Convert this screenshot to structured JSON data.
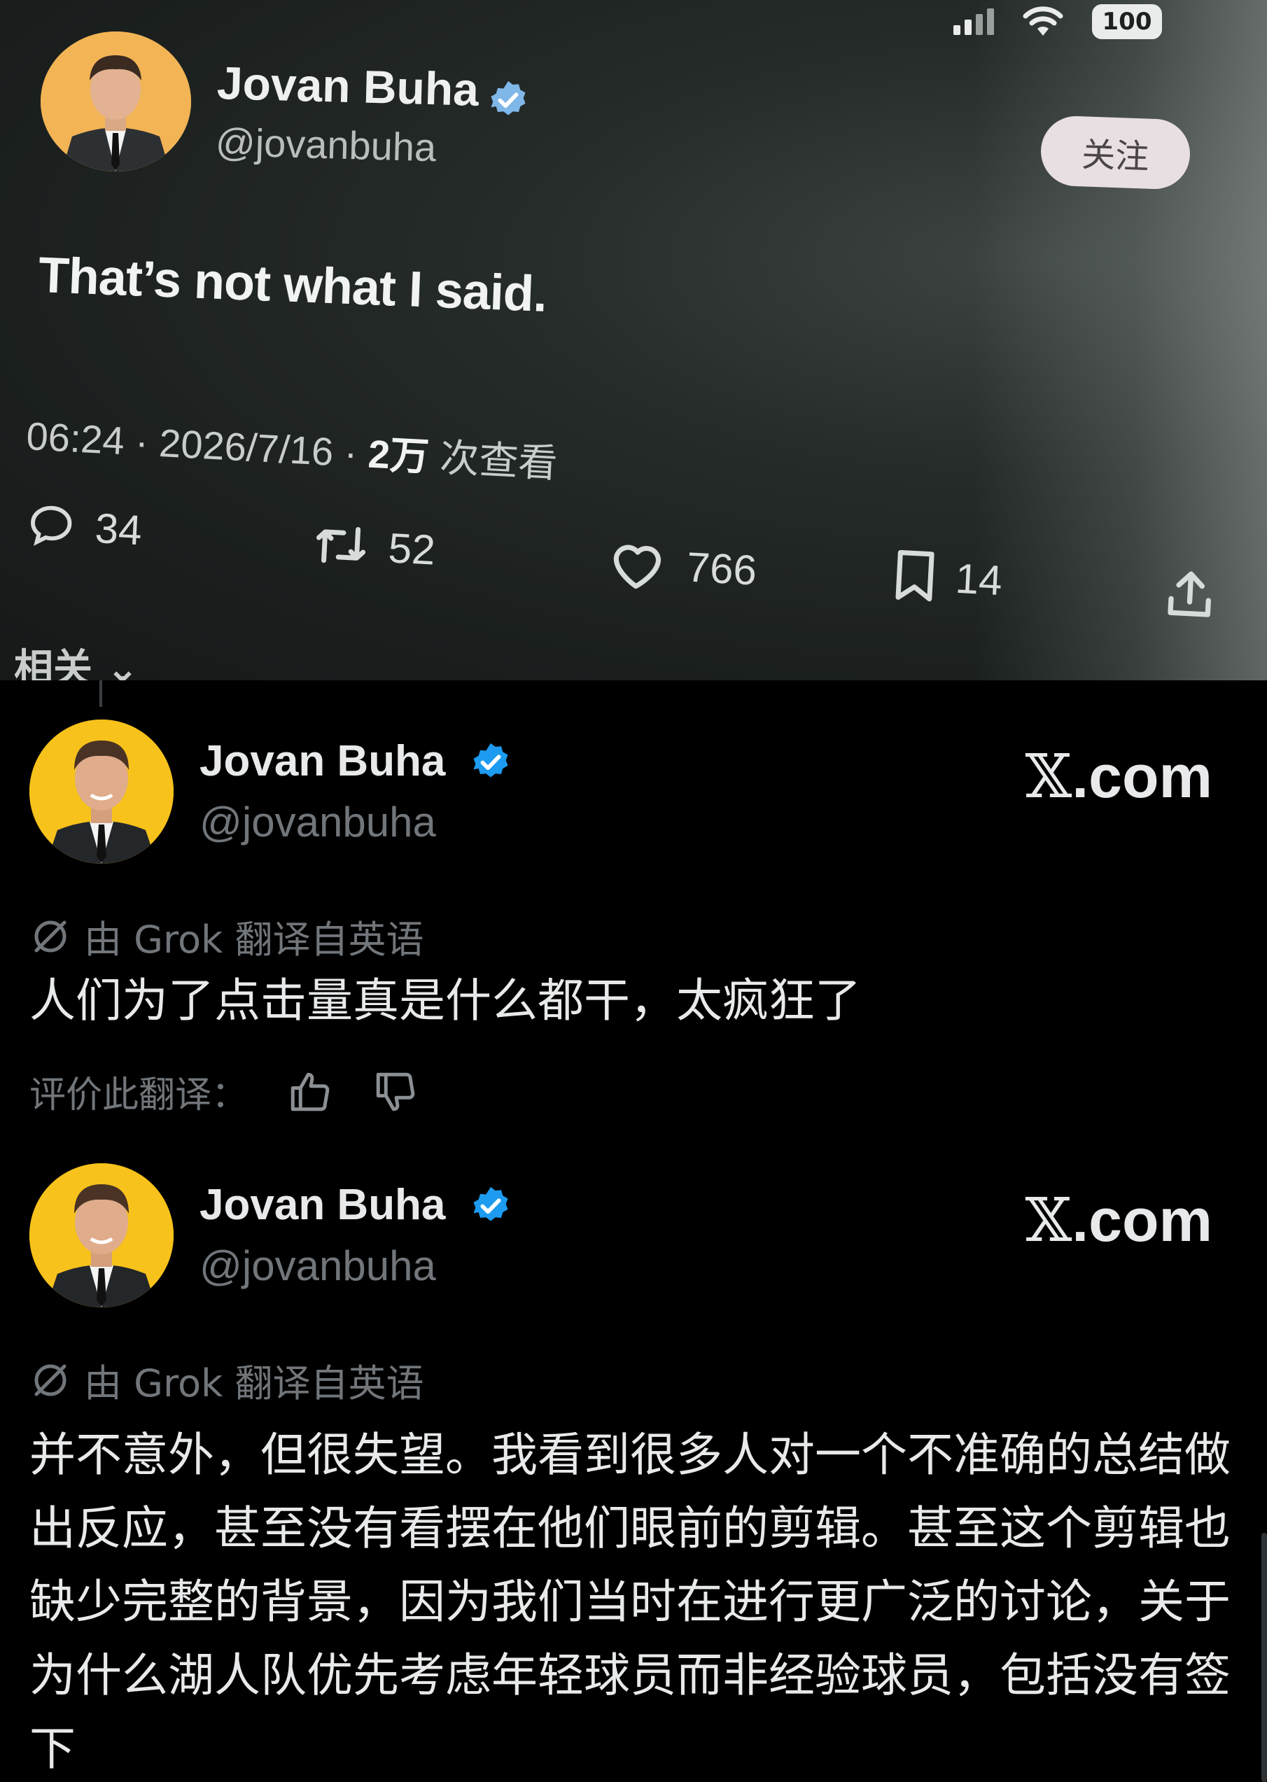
{
  "photo": {
    "status": {
      "battery": "100"
    },
    "author": {
      "name": "Jovan Buha",
      "handle": "@jovanbuha"
    },
    "follow_label": "关注",
    "text": "That’s not what I said.",
    "meta": {
      "time": "06:24",
      "date": "2026/7/16",
      "views": "2万",
      "views_label": "次查看"
    },
    "actions": {
      "replies": "34",
      "reposts": "52",
      "likes": "766",
      "bookmarks": "14"
    },
    "related": "相关"
  },
  "cards": [
    {
      "name": "Jovan Buha",
      "handle": "@jovanbuha",
      "brand_x": "𝕏",
      "brand_rest": ".com",
      "translation_note": "由 Grok 翻译自英语",
      "body": "人们为了点击量真是什么都干，太疯狂了",
      "rate_label": "评价此翻译："
    },
    {
      "name": "Jovan Buha",
      "handle": "@jovanbuha",
      "brand_x": "𝕏",
      "brand_rest": ".com",
      "translation_note": "由 Grok 翻译自英语",
      "body": "并不意外，但很失望。我看到很多人对一个不准确的总结做出反应，甚至没有看摆在他们眼前的剪辑。甚至这个剪辑也缺少完整的背景，因为我们当时在进行更广泛的讨论，关于为什么湖人队优先考虑年轻球员而非经验球员，包括没有签下"
    }
  ],
  "colors": {
    "verified": "#1d9bf0",
    "avatar_bg": "#f7c21b",
    "muted": "#71767b",
    "text": "#e7e9ea"
  }
}
